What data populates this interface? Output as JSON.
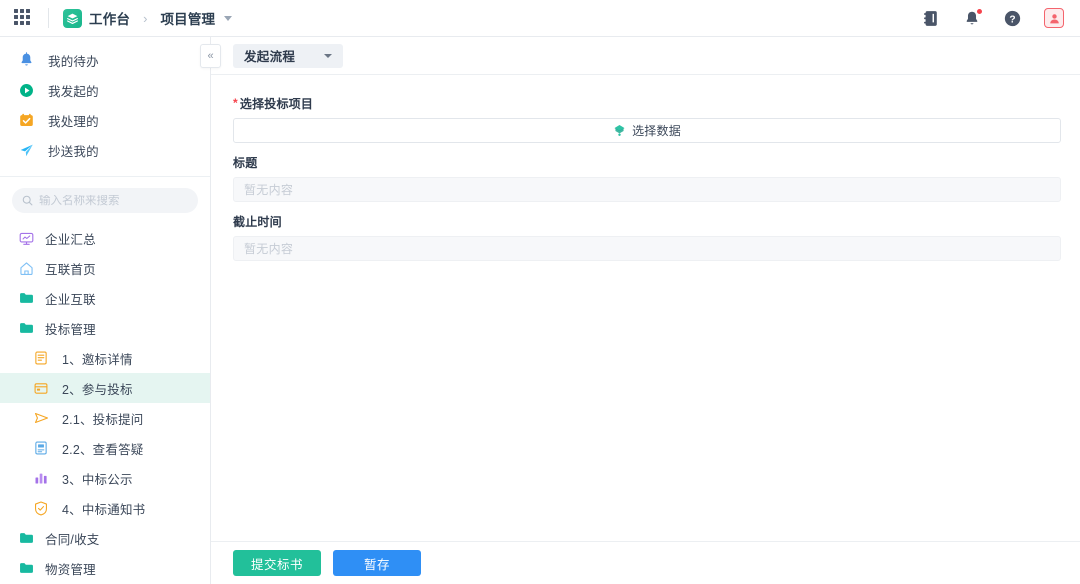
{
  "topbar": {
    "apps_icon": "grid-apps-icon",
    "logo_icon": "stack-logo-icon",
    "workbench": "工作台",
    "separator": "›",
    "module": "项目管理",
    "caret_icon": "chevron-down-icon",
    "actions": [
      {
        "name": "notebook-icon",
        "glyph": "book"
      },
      {
        "name": "bell-icon",
        "glyph": "bell",
        "has_badge": true
      },
      {
        "name": "help-icon",
        "glyph": "question"
      },
      {
        "name": "user-avatar-icon",
        "glyph": "person"
      }
    ],
    "colors": {
      "badge": "#f5434c",
      "avatar_border": "#f4646d",
      "logo": "#22b68c"
    }
  },
  "sidebar": {
    "quick_items": [
      {
        "label": "我的待办",
        "icon": "bell-icon",
        "color": "#4a90e2"
      },
      {
        "label": "我发起的",
        "icon": "play-circle-icon",
        "color": "#00b388"
      },
      {
        "label": "我处理的",
        "icon": "check-square-icon",
        "color": "#f5a623"
      },
      {
        "label": "抄送我的",
        "icon": "paper-plane-icon",
        "color": "#29b6f6"
      }
    ],
    "search": {
      "placeholder": "输入名称来搜索",
      "value": "",
      "icon": "search-icon"
    },
    "nav_items": [
      {
        "label": "企业汇总",
        "icon": "monitor-icon",
        "color": "#a472e8",
        "level": 0,
        "selected": false
      },
      {
        "label": "互联首页",
        "icon": "home-icon",
        "color": "#7fc0f5",
        "level": 0,
        "selected": false
      },
      {
        "label": "企业互联",
        "icon": "folder-icon",
        "color": "#17b9a0",
        "level": 0,
        "selected": false
      },
      {
        "label": "投标管理",
        "icon": "folder-icon",
        "color": "#17b9a0",
        "level": 0,
        "selected": false
      },
      {
        "label": "1、邀标详情",
        "icon": "document-icon",
        "color": "#f5a623",
        "level": 1,
        "selected": false
      },
      {
        "label": "2、参与投标",
        "icon": "card-icon",
        "color": "#f5a623",
        "level": 1,
        "selected": true
      },
      {
        "label": "2.1、投标提问",
        "icon": "send-icon",
        "color": "#f5a623",
        "level": 1,
        "selected": false
      },
      {
        "label": "2.2、查看答疑",
        "icon": "document-blue-icon",
        "color": "#5aa9e6",
        "level": 1,
        "selected": false
      },
      {
        "label": "3、中标公示",
        "icon": "bar-chart-icon",
        "color": "#a472e8",
        "level": 1,
        "selected": false
      },
      {
        "label": "4、中标通知书",
        "icon": "shield-check-icon",
        "color": "#f5a623",
        "level": 1,
        "selected": false
      },
      {
        "label": "合同/收支",
        "icon": "folder-icon",
        "color": "#17b9a0",
        "level": 0,
        "selected": false
      },
      {
        "label": "物资管理",
        "icon": "folder-icon",
        "color": "#17b9a0",
        "level": 0,
        "selected": false
      }
    ],
    "collapse_icon": "«",
    "selected_bg": "#e5f5f1"
  },
  "main": {
    "flow_tab": {
      "label": "发起流程",
      "caret_icon": "chevron-down-icon"
    },
    "fields": [
      {
        "label": "选择投标项目",
        "required": true,
        "type": "picker",
        "action_label": "选择数据",
        "action_icon": "select-data-icon",
        "value": ""
      },
      {
        "label": "标题",
        "required": false,
        "type": "readonly",
        "value": "暂无内容"
      },
      {
        "label": "截止时间",
        "required": false,
        "type": "readonly",
        "value": "暂无内容"
      }
    ],
    "footer": {
      "submit_label": "提交标书",
      "save_label": "暂存",
      "submit_color": "#22c09a",
      "save_color": "#2f8ff5"
    }
  }
}
